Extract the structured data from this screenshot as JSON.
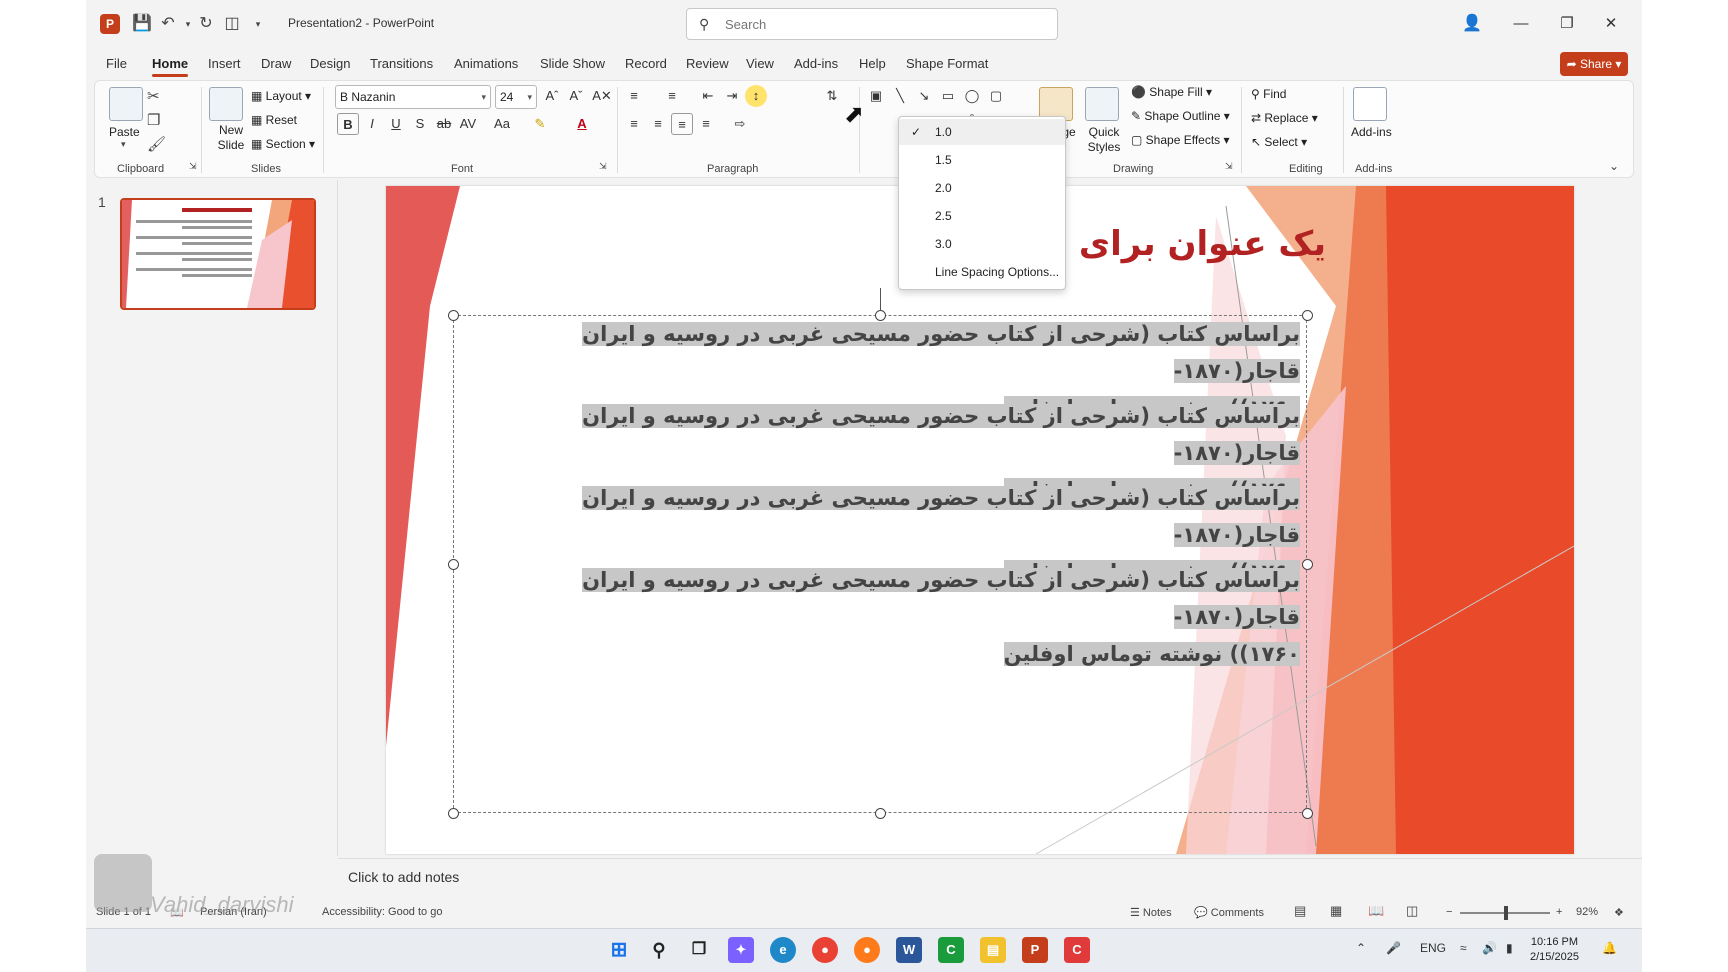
{
  "titlebar": {
    "doc_title": "Presentation2 - PowerPoint",
    "search_placeholder": "Search",
    "icons": [
      "save-icon",
      "undo-icon",
      "redo-icon",
      "present-icon",
      "customize-icon"
    ]
  },
  "menu": {
    "tabs": [
      "File",
      "Home",
      "Insert",
      "Draw",
      "Design",
      "Transitions",
      "Animations",
      "Slide Show",
      "Record",
      "Review",
      "View",
      "Add-ins",
      "Help",
      "Shape Format"
    ],
    "active": "Home",
    "share_label": "Share"
  },
  "ribbon": {
    "clipboard": {
      "label": "Clipboard",
      "paste": "Paste"
    },
    "slides": {
      "label": "Slides",
      "new_slide": "New Slide",
      "layout": "Layout",
      "reset": "Reset",
      "section": "Section"
    },
    "font": {
      "label": "Font",
      "font_name": "B Nazanin",
      "font_size": "24"
    },
    "paragraph": {
      "label": "Paragraph"
    },
    "drawing": {
      "label": "Drawing",
      "arrange": "Arrange",
      "quick_styles": "Quick Styles",
      "shape_fill": "Shape Fill",
      "shape_outline": "Shape Outline",
      "shape_effects": "Shape Effects"
    },
    "editing": {
      "label": "Editing",
      "find": "Find",
      "replace": "Replace",
      "select": "Select"
    },
    "addins": {
      "label": "Add-ins",
      "button": "Add-ins"
    }
  },
  "line_spacing_menu": {
    "items": [
      "1.0",
      "1.5",
      "2.0",
      "2.5",
      "3.0"
    ],
    "selected": "1.0",
    "options_label": "Line Spacing Options..."
  },
  "thumbnails": {
    "slide_number": "1"
  },
  "slide": {
    "title": "یک عنوان برای تست",
    "paragraph_line1": "براساس کتاب (شرحی از کتاب حضور مسیحی غربی در روسیه و ایران قاجار(۱۸۷۰-",
    "paragraph_line2": "۱۷۶۰)) نوشته توماس اوفلین",
    "paragraph_count": 4
  },
  "notes": {
    "placeholder": "Click to add notes"
  },
  "status": {
    "slide_info": "Slide 1 of 1",
    "language": "Persian (Iran)",
    "accessibility": "Accessibility: Good to go",
    "notes": "Notes",
    "comments": "Comments",
    "zoom": "92%"
  },
  "taskbar": {
    "lang": "ENG",
    "time": "10:16 PM",
    "date": "2/15/2025"
  },
  "watermark": "Vahid_darvishi",
  "colors": {
    "accent": "#c43e1c",
    "title_red": "#b22222",
    "highlight": "#c7c7c7"
  }
}
